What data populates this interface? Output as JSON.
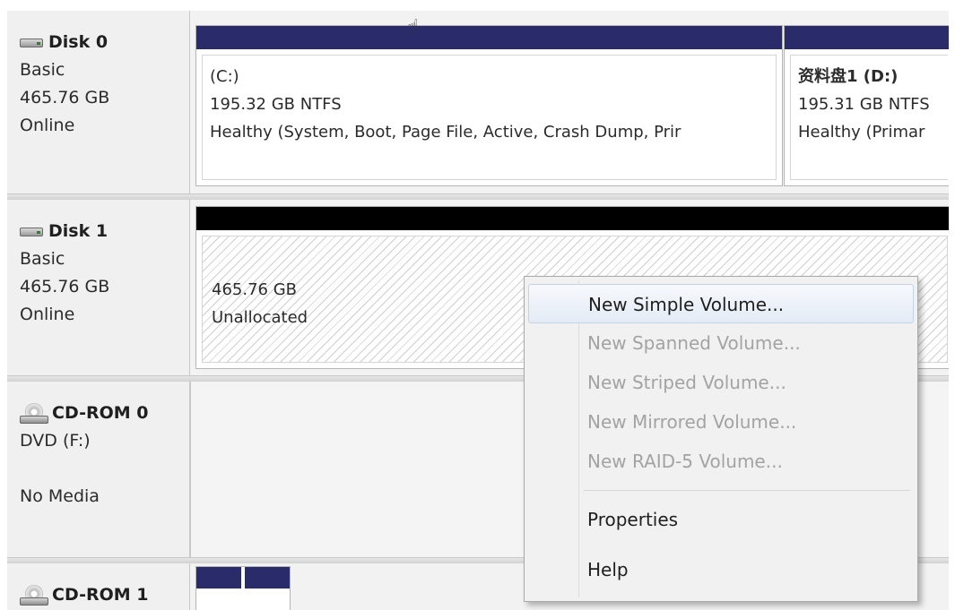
{
  "colors": {
    "primary_bar": "#2a2b6b",
    "unallocated_bar": "#000000",
    "menu_highlight": "#e3ebf5"
  },
  "disks": [
    {
      "name": "Disk 0",
      "type": "Basic",
      "size": "465.76 GB",
      "status": "Online",
      "icon": "hard-disk-icon"
    },
    {
      "name": "Disk 1",
      "type": "Basic",
      "size": "465.76 GB",
      "status": "Online",
      "icon": "hard-disk-icon"
    },
    {
      "name": "CD-ROM 0",
      "drive": "DVD (F:)",
      "status": "No Media",
      "icon": "cd-drive-icon"
    },
    {
      "name": "CD-ROM 1",
      "icon": "cd-drive-icon"
    }
  ],
  "partitions": {
    "c": {
      "name": "(C:)",
      "fs": "195.32 GB NTFS",
      "health": "Healthy (System, Boot, Page File, Active, Crash Dump, Prir"
    },
    "d": {
      "name": "资料盘1 (D:)",
      "fs": "195.31 GB NTFS",
      "health": "Healthy (Primar"
    },
    "unallocated": {
      "size": "465.76 GB",
      "label": "Unallocated"
    }
  },
  "context_menu": {
    "items": [
      {
        "label": "New Simple Volume...",
        "enabled": true,
        "highlighted": true
      },
      {
        "label": "New Spanned Volume...",
        "enabled": false
      },
      {
        "label": "New Striped Volume...",
        "enabled": false
      },
      {
        "label": "New Mirrored Volume...",
        "enabled": false
      },
      {
        "label": "New RAID-5 Volume...",
        "enabled": false
      },
      {
        "label": "Properties",
        "enabled": true
      },
      {
        "label": "Help",
        "enabled": true
      }
    ]
  }
}
